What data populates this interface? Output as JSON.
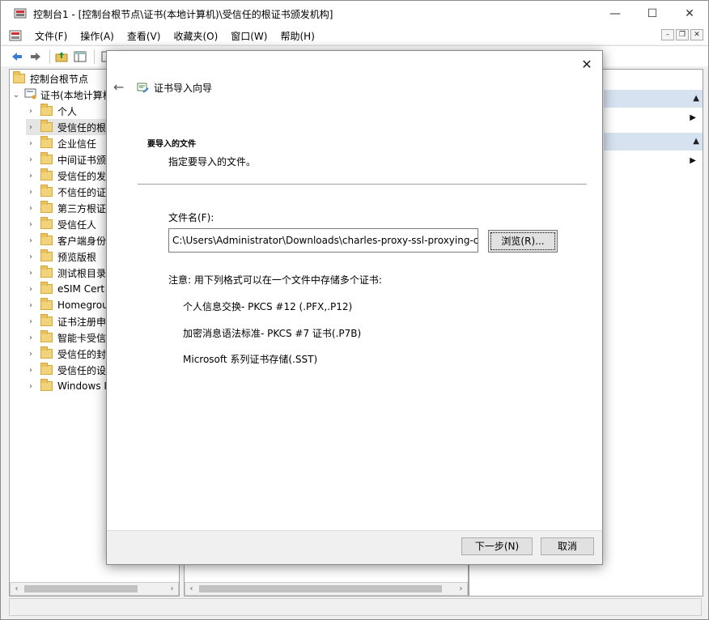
{
  "window": {
    "title": "控制台1 - [控制台根节点\\证书(本地计算机)\\受信任的根证书颁发机构]",
    "minimize": "—",
    "maximize": "☐",
    "close": "✕"
  },
  "menubar": {
    "items": [
      "文件(F)",
      "操作(A)",
      "查看(V)",
      "收藏夹(O)",
      "窗口(W)",
      "帮助(H)"
    ],
    "mdi_minimize": "–",
    "mdi_restore": "❐",
    "mdi_close": "✕"
  },
  "toolbar": {
    "icons": [
      "back-arrow-icon",
      "forward-arrow-icon",
      "up-folder-icon",
      "show-hide-tree-icon",
      "properties-icon",
      "help-icon"
    ]
  },
  "tree": {
    "root": "控制台根节点",
    "cert_node": "证书(本地计算机",
    "items": [
      "个人",
      "受信任的根",
      "企业信任",
      "中间证书颁",
      "受信任的发",
      "不信任的证",
      "第三方根证",
      "受信任人",
      "客户端身份",
      "预览版根",
      "测试根目录",
      "eSIM Cert",
      "Homegrou",
      "证书注册申",
      "智能卡受信",
      "受信任的封",
      "受信任的设",
      "Windows I"
    ]
  },
  "scroll": {
    "left": "‹",
    "right": "›"
  },
  "actions": {
    "collapse_glyph": "▲",
    "more_glyph": "▶"
  },
  "dialog": {
    "close": "✕",
    "back": "←",
    "title": "证书导入向导",
    "section_title": "要导入的文件",
    "section_subtitle": "指定要导入的文件。",
    "file_label": "文件名(F):",
    "file_value": "C:\\Users\\Administrator\\Downloads\\charles-proxy-ssl-proxying-ce",
    "browse_label": "浏览(R)...",
    "note": "注意: 用下列格式可以在一个文件中存储多个证书:",
    "formats": [
      "个人信息交换- PKCS #12 (.PFX,.P12)",
      "加密消息语法标准- PKCS #7 证书(.P7B)",
      "Microsoft 系列证书存储(.SST)"
    ],
    "next_label": "下一步(N)",
    "cancel_label": "取消"
  },
  "colors": {
    "accent": "#3a6fb5",
    "selected_row": "#e5e5e5",
    "action_header": "#d6e2ef"
  }
}
